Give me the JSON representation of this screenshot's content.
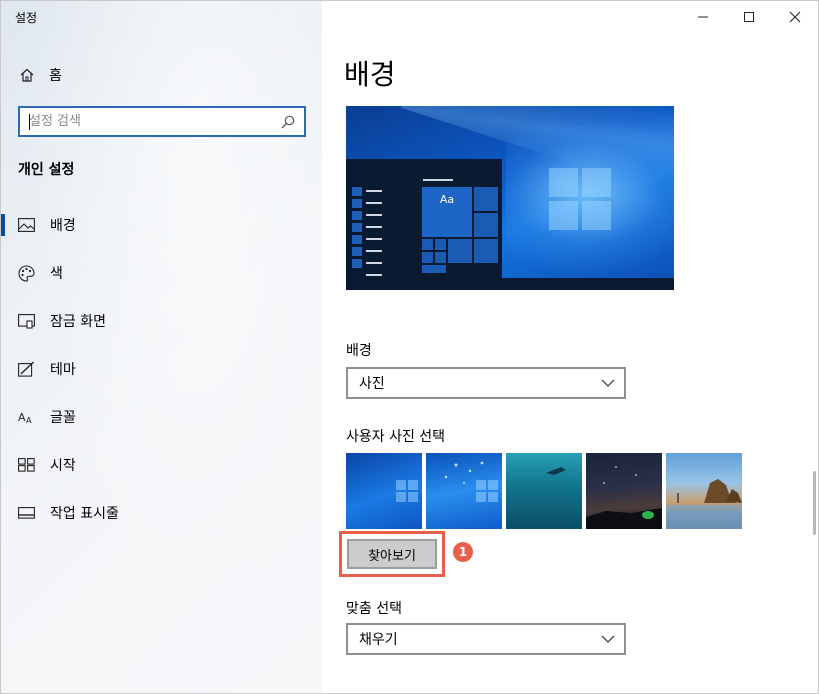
{
  "window": {
    "title": "설정",
    "controls": {
      "minimize": "minimize",
      "maximize": "maximize",
      "close": "close"
    }
  },
  "sidebar": {
    "home_label": "홈",
    "search_placeholder": "설정 검색",
    "section_title": "개인 설정",
    "items": [
      {
        "label": "배경",
        "icon": "picture-icon",
        "active": true
      },
      {
        "label": "색",
        "icon": "palette-icon",
        "active": false
      },
      {
        "label": "잠금 화면",
        "icon": "lock-screen-icon",
        "active": false
      },
      {
        "label": "테마",
        "icon": "theme-icon",
        "active": false
      },
      {
        "label": "글꼴",
        "icon": "font-icon",
        "active": false
      },
      {
        "label": "시작",
        "icon": "start-icon",
        "active": false
      },
      {
        "label": "작업 표시줄",
        "icon": "taskbar-icon",
        "active": false
      }
    ]
  },
  "main": {
    "page_title": "배경",
    "preview_tile_text": "Aa",
    "background_label": "배경",
    "background_value": "사진",
    "choose_picture_label": "사용자 사진 선택",
    "browse_label": "찾아보기",
    "step_badge": "1",
    "fit_label": "맞춤 선택",
    "fit_value": "채우기"
  },
  "colors": {
    "accent": "#0a4ea0",
    "highlight": "#e8604c",
    "search_border": "#2b6cb0"
  }
}
